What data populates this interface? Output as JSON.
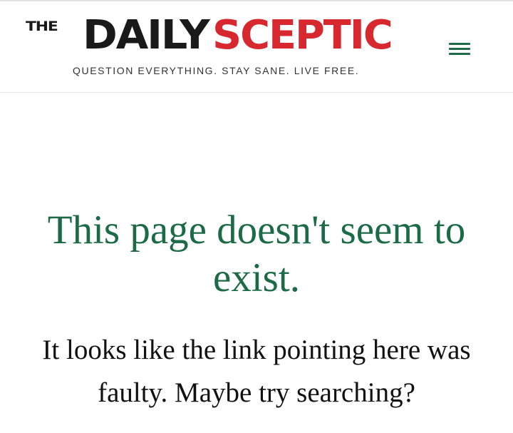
{
  "header": {
    "logo": {
      "the": "THE",
      "daily": "DAILY",
      "sceptic": "SCEPTIC"
    },
    "tagline": "QUESTION EVERYTHING. STAY SANE. LIVE FREE.",
    "menu_icon": "hamburger-menu-icon"
  },
  "colors": {
    "brand_red": "#d7282f",
    "brand_green": "#1d6a48",
    "text_dark": "#111111"
  },
  "main": {
    "title": "This page doesn't seem to exist.",
    "message": "It looks like the link pointing here was faulty. Maybe try searching?"
  }
}
